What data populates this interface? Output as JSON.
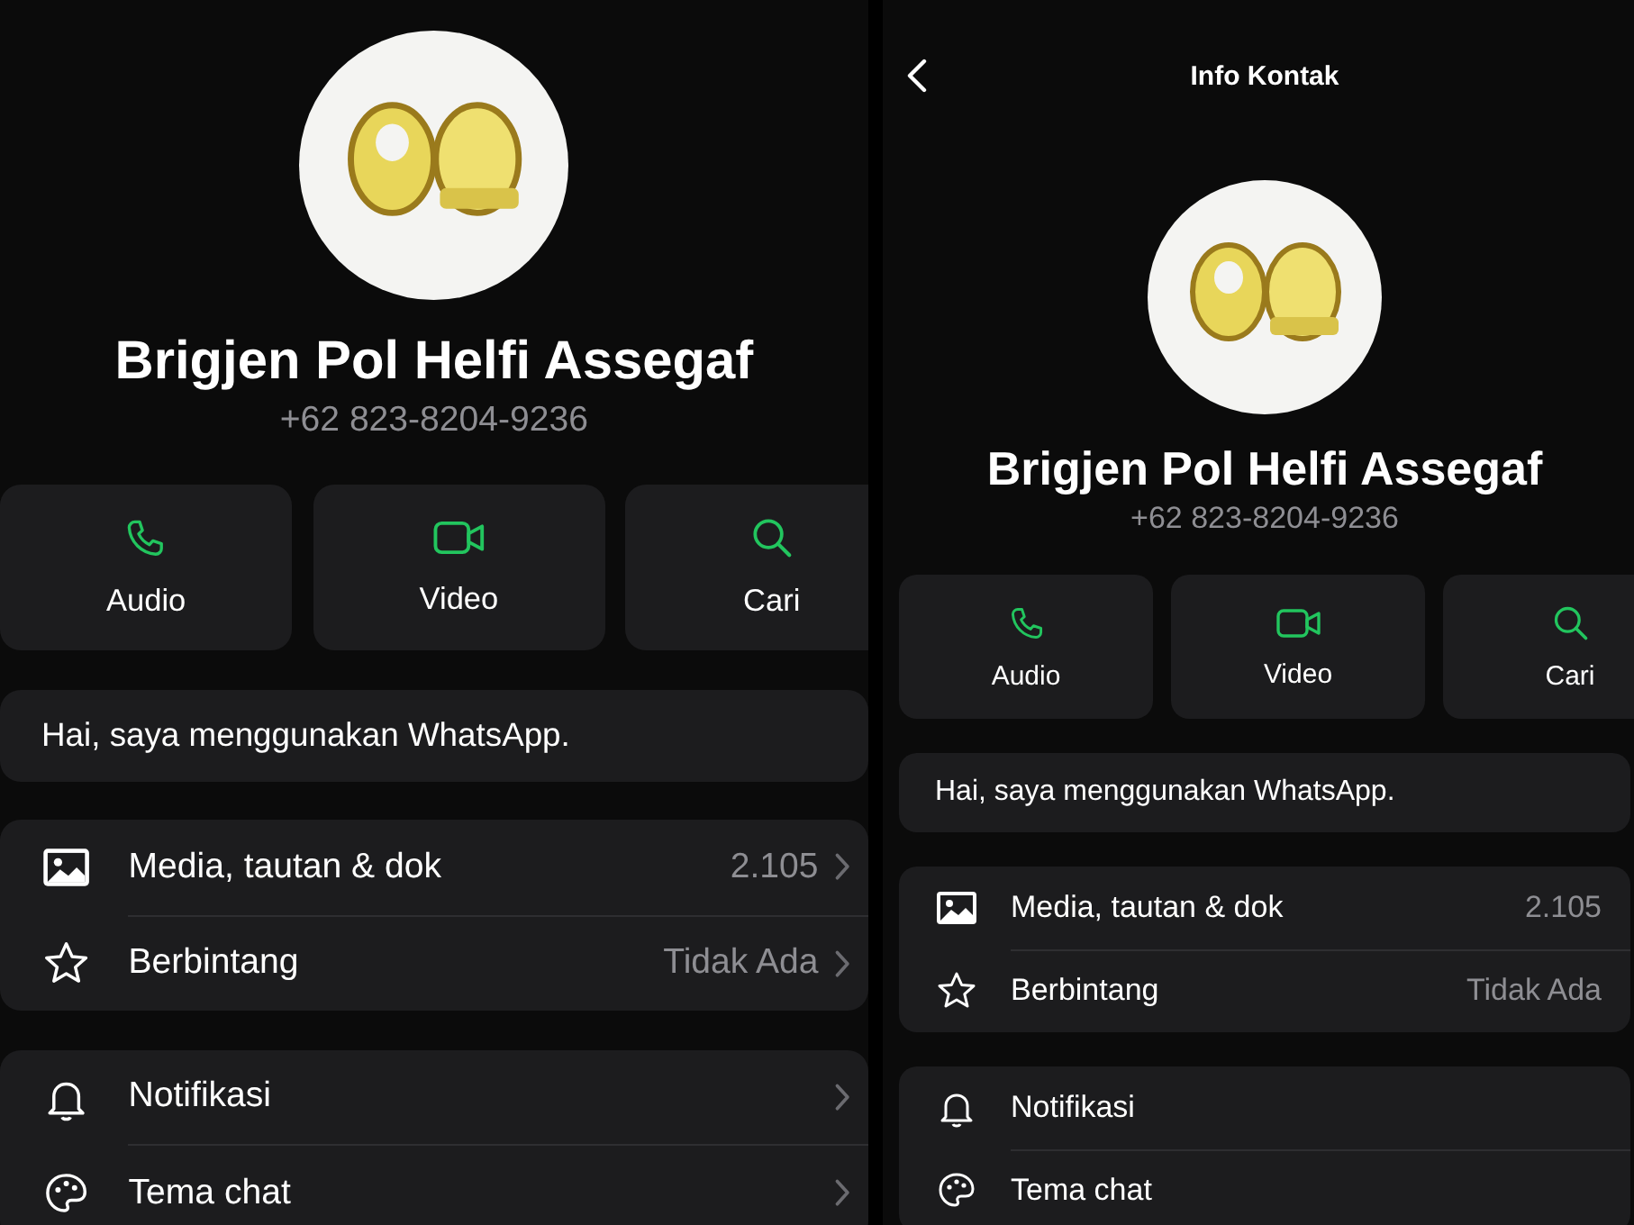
{
  "panels": [
    {
      "name": "Brigjen Pol Helfi Assegaf",
      "phone": "+62 823-8204-9236",
      "actions": [
        {
          "kind": "audio",
          "label": "Audio"
        },
        {
          "kind": "video",
          "label": "Video"
        },
        {
          "kind": "search",
          "label": "Cari"
        }
      ],
      "about": "Hai, saya menggunakan WhatsApp.",
      "groups": [
        [
          {
            "kind": "media",
            "label": "Media, tautan & dok",
            "value": "2.105",
            "chevron": true
          },
          {
            "kind": "starred",
            "label": "Berbintang",
            "value": "Tidak Ada",
            "chevron": true
          }
        ],
        [
          {
            "kind": "notifications",
            "label": "Notifikasi",
            "chevron": true
          },
          {
            "kind": "theme",
            "label": "Tema chat",
            "chevron": true
          }
        ]
      ]
    },
    {
      "header": {
        "title": "Info Kontak"
      },
      "name": "Brigjen Pol Helfi Assegaf",
      "phone": "+62 823-8204-9236",
      "actions": [
        {
          "kind": "audio",
          "label": "Audio"
        },
        {
          "kind": "video",
          "label": "Video"
        },
        {
          "kind": "search",
          "label": "Cari"
        }
      ],
      "about": "Hai, saya menggunakan WhatsApp.",
      "groups": [
        [
          {
            "kind": "media",
            "label": "Media, tautan & dok",
            "value": "2.105",
            "chevron": false
          },
          {
            "kind": "starred",
            "label": "Berbintang",
            "value": "Tidak Ada",
            "chevron": false
          }
        ],
        [
          {
            "kind": "notifications",
            "label": "Notifikasi",
            "chevron": false
          },
          {
            "kind": "theme",
            "label": "Tema chat",
            "chevron": false
          }
        ]
      ]
    }
  ]
}
